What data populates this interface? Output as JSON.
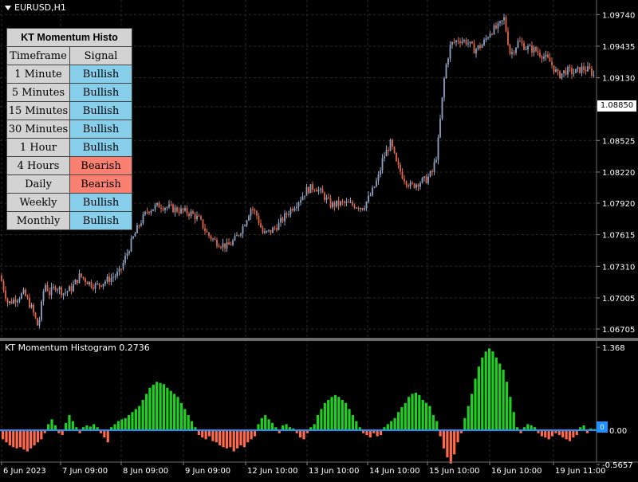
{
  "main": {
    "symbol_title": "EURUSD,H1",
    "y_ticks": [
      "1.09740",
      "1.09435",
      "1.09130",
      "1.08850",
      "1.08525",
      "1.08220",
      "1.07920",
      "1.07615",
      "1.07310",
      "1.07005",
      "1.06705"
    ],
    "y_tick_values": [
      1.0974,
      1.09435,
      1.0913,
      1.0885,
      1.08525,
      1.0822,
      1.0792,
      1.07615,
      1.0731,
      1.07005,
      1.06705
    ],
    "current_price": "1.08850",
    "bull_color": "#8ea2c2",
    "bear_color": "#e0664a",
    "grid_color": "#2a2a2a"
  },
  "table": {
    "title": "KT Momentum Histo",
    "col_timeframe": "Timeframe",
    "col_signal": "Signal",
    "bull_color": "#87ceeb",
    "bear_color": "#fa8072",
    "rows": [
      {
        "timeframe": "1 Minute",
        "signal": "Bullish"
      },
      {
        "timeframe": "5 Minutes",
        "signal": "Bullish"
      },
      {
        "timeframe": "15 Minutes",
        "signal": "Bullish"
      },
      {
        "timeframe": "30 Minutes",
        "signal": "Bullish"
      },
      {
        "timeframe": "1 Hour",
        "signal": "Bullish"
      },
      {
        "timeframe": "4 Hours",
        "signal": "Bearish"
      },
      {
        "timeframe": "Daily",
        "signal": "Bearish"
      },
      {
        "timeframe": "Weekly",
        "signal": "Bullish"
      },
      {
        "timeframe": "Monthly",
        "signal": "Bullish"
      }
    ]
  },
  "indicator": {
    "title": "KT Momentum Histogram 0.2736",
    "y_ticks": [
      "1.368",
      "0.00",
      "-0.5657"
    ],
    "zero_marker": "0",
    "pos_color": "#20d020",
    "neg_color": "#ff6a4a",
    "zero_line_color": "#1e90ff"
  },
  "x_axis": {
    "labels": [
      "6 Jun 2023",
      "7 Jun 09:00",
      "8 Jun 09:00",
      "9 Jun 09:00",
      "12 Jun 10:00",
      "13 Jun 10:00",
      "14 Jun 10:00",
      "15 Jun 10:00",
      "16 Jun 10:00",
      "19 Jun 11:00"
    ]
  },
  "chart_data": [
    {
      "type": "line",
      "title": "EURUSD,H1",
      "ylabel": "",
      "ylim": [
        1.0662,
        1.0985
      ],
      "x": [
        "6 Jun 2023",
        "7 Jun 09:00",
        "8 Jun 09:00",
        "9 Jun 09:00",
        "12 Jun 10:00",
        "13 Jun 10:00",
        "14 Jun 10:00",
        "15 Jun 10:00",
        "16 Jun 10:00",
        "19 Jun 11:00"
      ],
      "anchor_closes": [
        [
          0,
          1.0722
        ],
        [
          10,
          1.0695
        ],
        [
          20,
          1.07
        ],
        [
          30,
          1.0705
        ],
        [
          40,
          1.069
        ],
        [
          48,
          1.0672
        ],
        [
          56,
          1.0715
        ],
        [
          62,
          1.0705
        ],
        [
          70,
          1.0712
        ],
        [
          80,
          1.0705
        ],
        [
          90,
          1.071
        ],
        [
          100,
          1.0722
        ],
        [
          112,
          1.0715
        ],
        [
          120,
          1.0712
        ],
        [
          130,
          1.0716
        ],
        [
          140,
          1.072
        ],
        [
          150,
          1.0725
        ],
        [
          155,
          1.0735
        ],
        [
          165,
          1.0755
        ],
        [
          175,
          1.0772
        ],
        [
          185,
          1.0785
        ],
        [
          200,
          1.079
        ],
        [
          215,
          1.0787
        ],
        [
          225,
          1.0785
        ],
        [
          240,
          1.0782
        ],
        [
          250,
          1.0776
        ],
        [
          260,
          1.0762
        ],
        [
          270,
          1.0755
        ],
        [
          285,
          1.075
        ],
        [
          295,
          1.0757
        ],
        [
          305,
          1.077
        ],
        [
          315,
          1.0788
        ],
        [
          322,
          1.078
        ],
        [
          330,
          1.0762
        ],
        [
          340,
          1.0765
        ],
        [
          350,
          1.0772
        ],
        [
          360,
          1.0782
        ],
        [
          375,
          1.0795
        ],
        [
          385,
          1.0805
        ],
        [
          395,
          1.0808
        ],
        [
          405,
          1.08
        ],
        [
          415,
          1.079
        ],
        [
          430,
          1.0792
        ],
        [
          445,
          1.079
        ],
        [
          455,
          1.0788
        ],
        [
          465,
          1.08
        ],
        [
          475,
          1.0818
        ],
        [
          480,
          1.0835
        ],
        [
          490,
          1.085
        ],
        [
          497,
          1.083
        ],
        [
          505,
          1.0818
        ],
        [
          515,
          1.0808
        ],
        [
          525,
          1.0812
        ],
        [
          535,
          1.0815
        ],
        [
          542,
          1.0822
        ],
        [
          548,
          1.084
        ],
        [
          553,
          1.088
        ],
        [
          558,
          1.092
        ],
        [
          565,
          1.0945
        ],
        [
          575,
          1.095
        ],
        [
          585,
          1.0948
        ],
        [
          595,
          1.094
        ],
        [
          605,
          1.0945
        ],
        [
          615,
          1.0958
        ],
        [
          625,
          1.0962
        ],
        [
          632,
          1.097
        ],
        [
          640,
          1.0935
        ],
        [
          650,
          1.0948
        ],
        [
          660,
          1.0942
        ],
        [
          670,
          1.094
        ],
        [
          680,
          1.0935
        ],
        [
          690,
          1.0928
        ],
        [
          700,
          1.0915
        ],
        [
          710,
          1.092
        ],
        [
          720,
          1.0918
        ],
        [
          730,
          1.0922
        ],
        [
          740,
          1.092
        ],
        [
          748,
          1.0912
        ]
      ]
    },
    {
      "type": "bar",
      "title": "KT Momentum Histogram 0.2736",
      "ylim": [
        -0.5657,
        1.368
      ],
      "series": [
        {
          "values": [
            -0.15,
            -0.2,
            -0.25,
            -0.28,
            -0.3,
            -0.28,
            -0.32,
            -0.35,
            -0.3,
            -0.25,
            -0.2,
            -0.15,
            -0.05,
            0.1,
            0.18,
            0.08,
            -0.05,
            -0.08,
            0.12,
            0.25,
            0.15,
            0.05,
            -0.05,
            0.05,
            0.08,
            0.06,
            0.1,
            0.05,
            -0.05,
            -0.12,
            -0.2,
            0.05,
            0.1,
            0.15,
            0.18,
            0.2,
            0.25,
            0.3,
            0.35,
            0.4,
            0.5,
            0.6,
            0.7,
            0.75,
            0.8,
            0.78,
            0.76,
            0.7,
            0.65,
            0.6,
            0.55,
            0.45,
            0.35,
            0.25,
            0.15,
            0.05,
            -0.08,
            -0.12,
            -0.15,
            -0.1,
            -0.18,
            -0.2,
            -0.25,
            -0.28,
            -0.3,
            -0.28,
            -0.35,
            -0.3,
            -0.25,
            -0.28,
            -0.2,
            -0.15,
            -0.1,
            0.1,
            0.2,
            0.25,
            0.18,
            0.12,
            0.05,
            -0.05,
            0.08,
            0.1,
            0.05,
            0.03,
            -0.05,
            -0.12,
            -0.15,
            -0.05,
            0.05,
            0.1,
            0.25,
            0.35,
            0.45,
            0.5,
            0.55,
            0.58,
            0.55,
            0.5,
            0.45,
            0.35,
            0.25,
            0.15,
            0.05,
            -0.05,
            -0.08,
            -0.12,
            -0.05,
            -0.1,
            -0.08,
            0.05,
            0.1,
            0.15,
            0.2,
            0.3,
            0.38,
            0.45,
            0.55,
            0.6,
            0.62,
            0.58,
            0.5,
            0.45,
            0.4,
            0.25,
            0.15,
            -0.1,
            -0.3,
            -0.45,
            -0.55,
            -0.4,
            -0.2,
            -0.05,
            0.2,
            0.4,
            0.6,
            0.85,
            1.05,
            1.2,
            1.3,
            1.35,
            1.3,
            1.2,
            1.1,
            1.0,
            0.8,
            0.55,
            0.3,
            0.05,
            -0.05,
            0.05,
            0.1,
            0.08,
            0.05,
            -0.05,
            -0.1,
            -0.12,
            -0.15,
            -0.1,
            -0.05,
            -0.08,
            -0.12,
            -0.15,
            -0.18,
            -0.12,
            -0.08,
            0.05,
            0.08,
            -0.05,
            0.03,
            0.02
          ]
        }
      ]
    }
  ]
}
